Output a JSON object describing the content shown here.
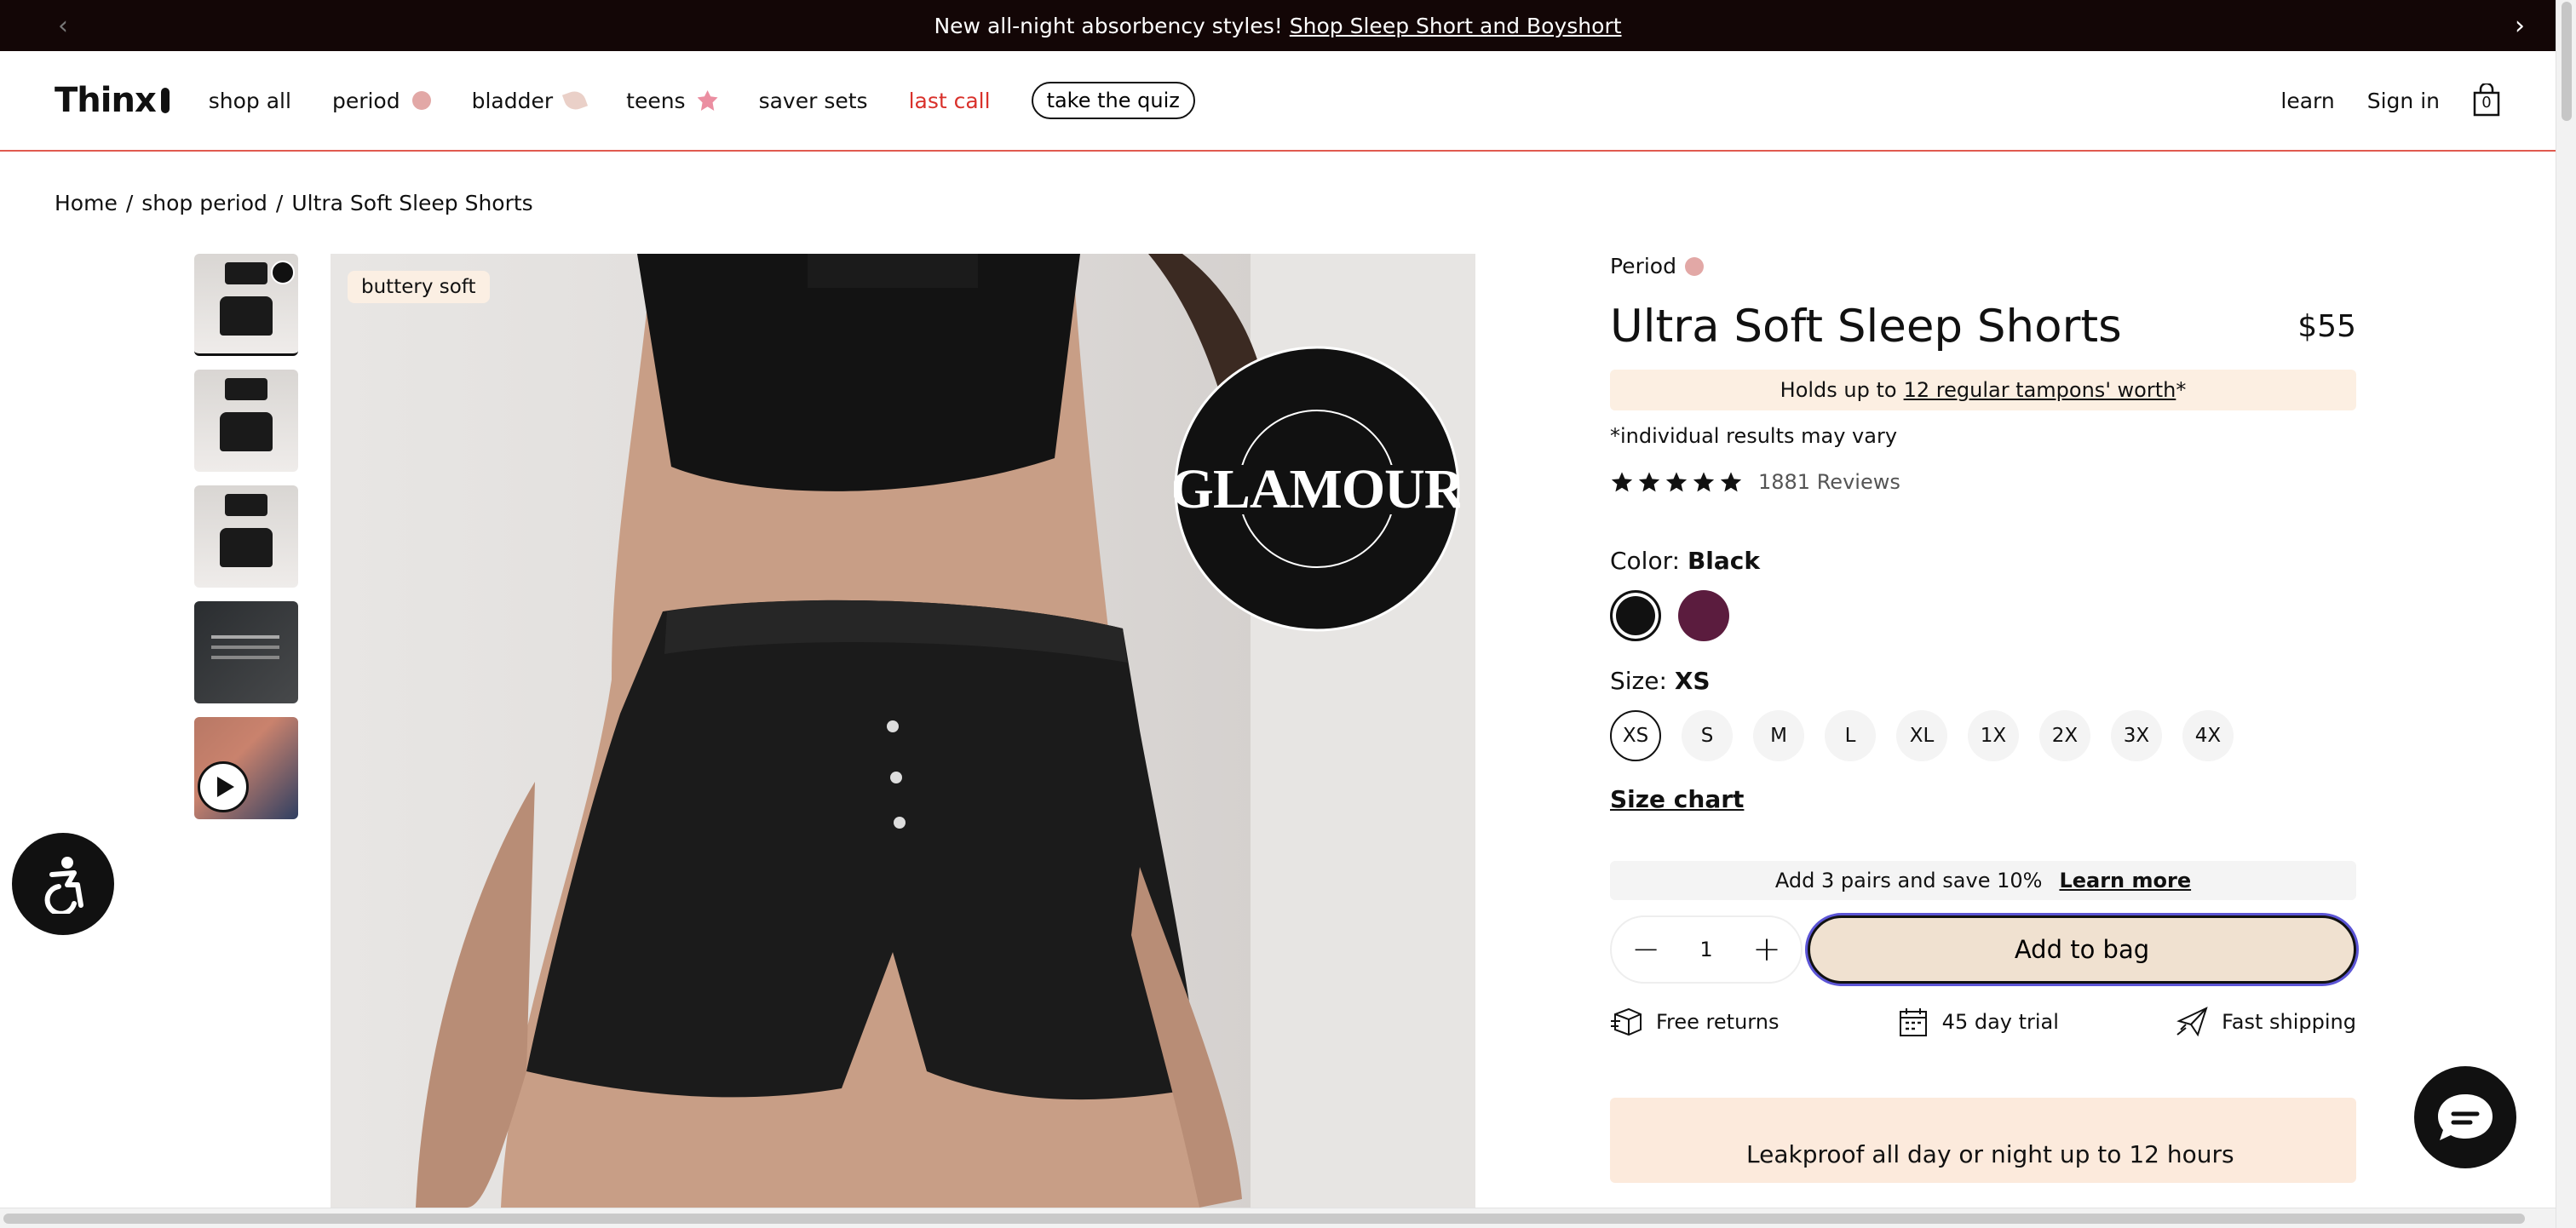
{
  "promo": {
    "text": "New all-night absorbency styles!",
    "link": "Shop Sleep Short and Boyshort"
  },
  "nav": {
    "logo": "Thinx",
    "items": [
      "shop all",
      "period",
      "bladder",
      "teens",
      "saver sets",
      "last call"
    ],
    "quiz": "take the quiz",
    "learn": "learn",
    "signin": "Sign in",
    "bag_count": "0"
  },
  "breadcrumb": [
    "Home",
    "/",
    "shop period",
    "/",
    "Ultra Soft Sleep Shorts"
  ],
  "gallery": {
    "badge": "buttery soft"
  },
  "product": {
    "category": "Period",
    "title": "Ultra Soft Sleep Shorts",
    "price": "$55",
    "holds_prefix": "Holds up to",
    "holds_link": "12 regular tampons' worth",
    "holds_suffix": "*",
    "disclaimer": "*individual results may vary",
    "rating": 5,
    "reviews": "1881 Reviews",
    "color_label": "Color:",
    "color_value": "Black",
    "size_label": "Size:",
    "size_value": "XS",
    "sizes": [
      "XS",
      "S",
      "M",
      "L",
      "XL",
      "1X",
      "2X",
      "3X",
      "4X"
    ],
    "size_chart": "Size chart",
    "bundle_text": "Add 3 pairs and save 10%",
    "bundle_link": "Learn more",
    "quantity": "1",
    "add_to_bag": "Add to bag",
    "perks": [
      "Free returns",
      "45 day trial",
      "Fast shipping"
    ],
    "leak_text": "Leakproof all day or night up to 12 hours"
  },
  "colors": {
    "black": "#111111",
    "plum": "#5b1c3e",
    "accent": "#d9312b",
    "cream": "#f0e1d0",
    "focus": "#5c55d6"
  }
}
